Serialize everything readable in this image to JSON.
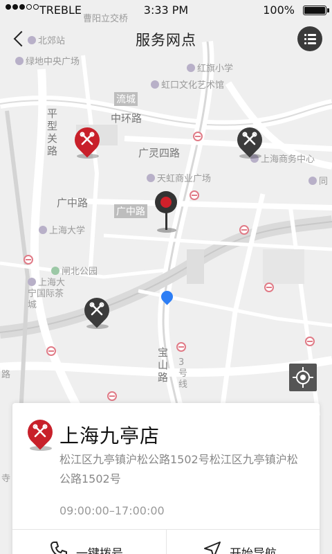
{
  "status_bar": {
    "carrier": "TREBLE",
    "time": "3:33 PM",
    "battery": "100%"
  },
  "header": {
    "title": "服务网点",
    "back_icon": "chevron-left-icon",
    "list_icon": "list-icon"
  },
  "map": {
    "labels": {
      "l1": "曹阳立交桥",
      "l2": "北郊站",
      "l3": "绿地中央广场",
      "l4": "红旗小学",
      "l5": "虹口文化艺术馆",
      "l6": "流城",
      "l7": "中环路",
      "l8": "平型关路",
      "l9": "广灵四路",
      "l10": "上海商务中心",
      "l11": "天虹商业广场",
      "l12": "同",
      "l13": "广中路",
      "l14": "广中路",
      "l15": "上海大学",
      "l16": "闸北公园",
      "l17": "上海大宁国际茶城",
      "l18": "宝山路",
      "l19": "3号线",
      "l20": "路",
      "l21": "寺"
    }
  },
  "card": {
    "name": "上海九亭店",
    "address": "松江区九亭镇沪松公路1502号松江区九亭镇沪松公路1502号",
    "hours": "09:00:00–17:00:00",
    "call_label": "一键拨号",
    "navigate_label": "开始导航"
  },
  "colors": {
    "accent_red": "#c8202a",
    "marker_dark": "#3b3b3b",
    "location_blue": "#2d7ef5"
  }
}
